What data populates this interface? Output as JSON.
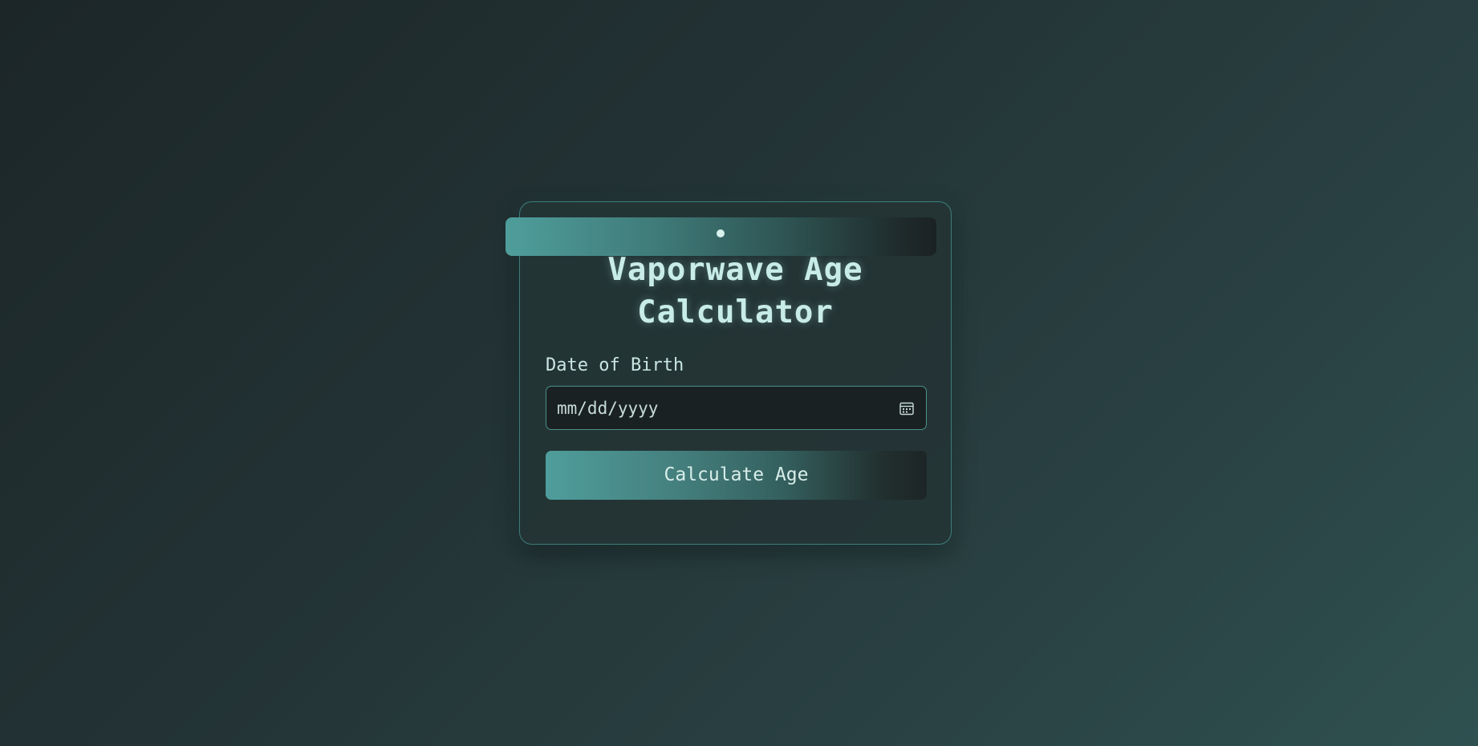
{
  "app": {
    "title_line1": "Vaporwave Age",
    "title_line2": "Calculator"
  },
  "form": {
    "dob_label": "Date of Birth",
    "dob_placeholder": "mm/dd/yyyy",
    "dob_value": "",
    "calculate_label": "Calculate Age"
  },
  "icons": {
    "calendar": "calendar-icon",
    "decor_dot": "dot-icon"
  },
  "colors": {
    "accent": "#4f9e9c",
    "text": "#c8ece8",
    "border": "#3d7d7a",
    "input_bg": "#1a2123"
  }
}
